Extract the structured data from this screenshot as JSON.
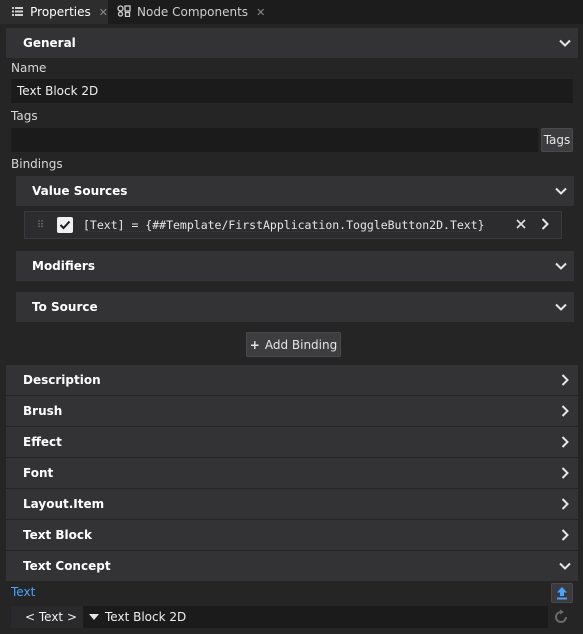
{
  "tabs": [
    {
      "label": "Properties",
      "icon": "list-icon",
      "active": true
    },
    {
      "label": "Node Components",
      "icon": "components-icon",
      "active": false
    }
  ],
  "general": {
    "title": "General",
    "name_label": "Name",
    "name_value": "Text Block 2D",
    "tags_label": "Tags",
    "tags_value": "",
    "tags_button": "Tags",
    "bindings_label": "Bindings",
    "value_sources_title": "Value Sources",
    "binding_expression": "[Text] = {##Template/FirstApplication.ToggleButton2D.Text}",
    "binding_enabled": true,
    "modifiers_title": "Modifiers",
    "to_source_title": "To Source",
    "add_binding_label": "Add Binding"
  },
  "sections": [
    {
      "title": "Description",
      "expanded": false
    },
    {
      "title": "Brush",
      "expanded": false
    },
    {
      "title": "Effect",
      "expanded": false
    },
    {
      "title": "Font",
      "expanded": false
    },
    {
      "title": "Layout.Item",
      "expanded": false
    },
    {
      "title": "Text Block",
      "expanded": false
    },
    {
      "title": "Text Concept",
      "expanded": true
    }
  ],
  "text_concept": {
    "text_label": "Text",
    "text_type_selector": "< Text >",
    "text_value": "Text Block 2D"
  }
}
